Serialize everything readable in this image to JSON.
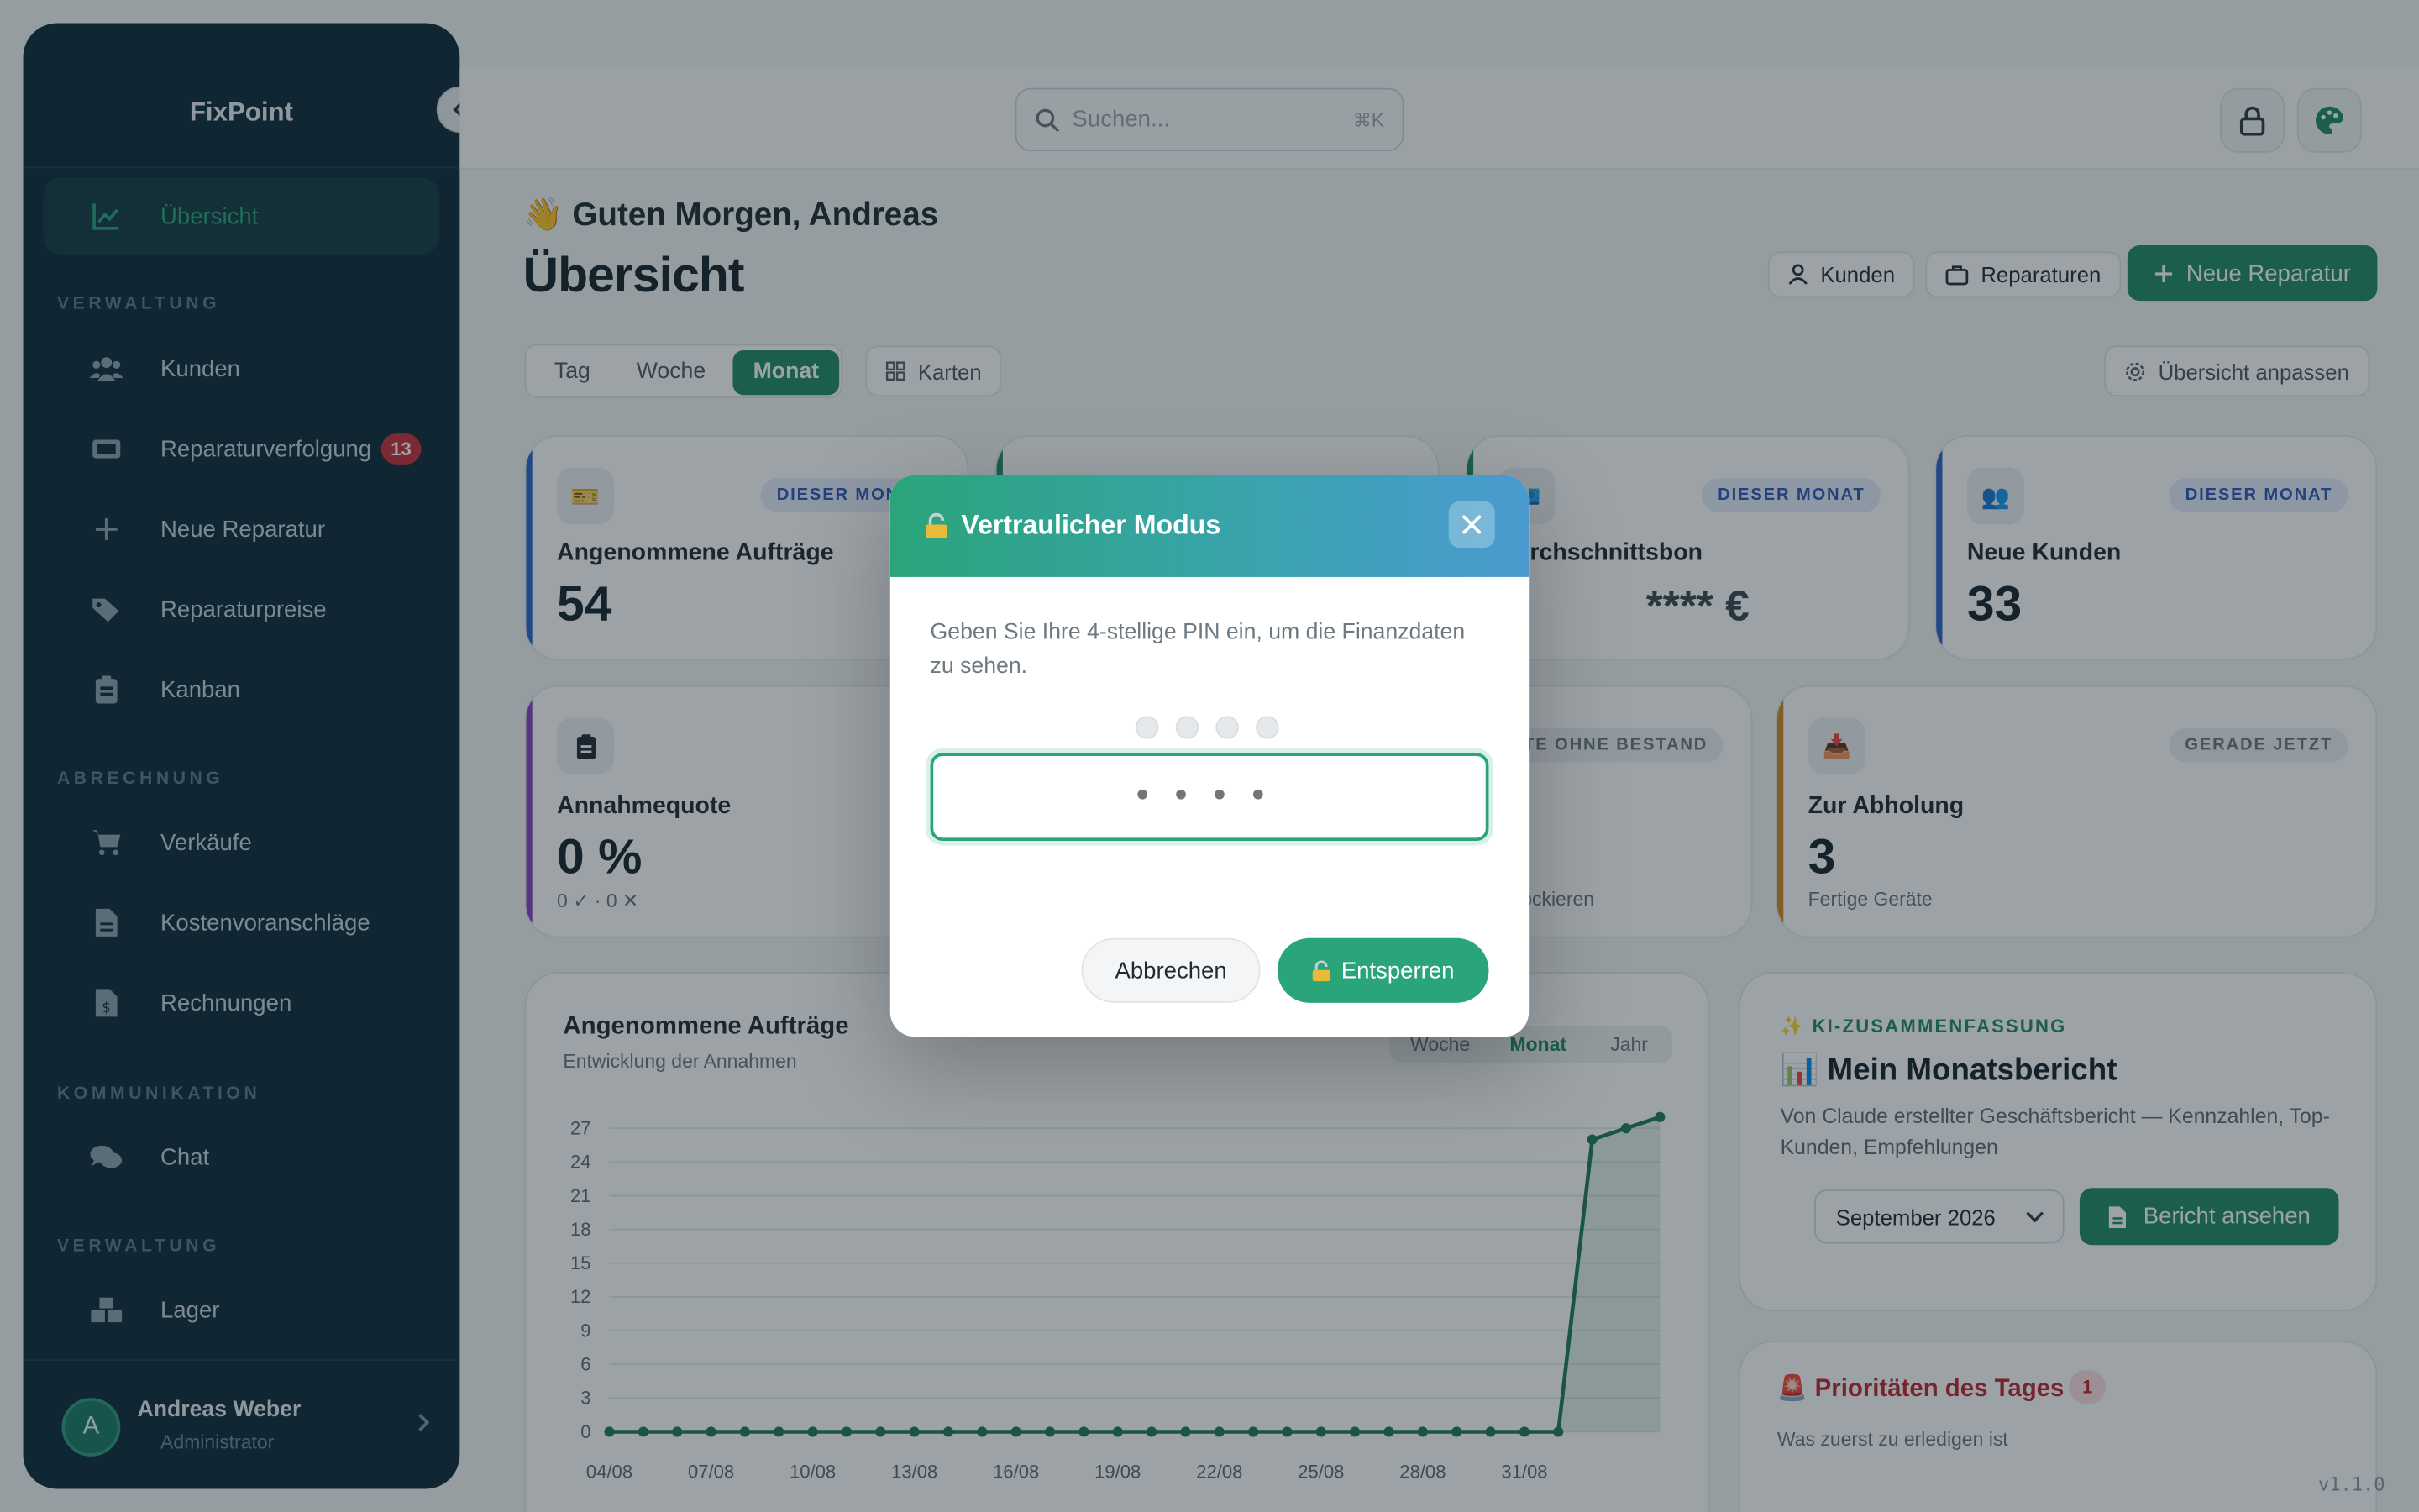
{
  "sidebar": {
    "brand": "FixPoint",
    "items": [
      {
        "label": "Übersicht",
        "icon": "chart-line-icon"
      },
      {
        "label": "Kunden",
        "icon": "users-icon"
      },
      {
        "label": "Reparaturverfolgung",
        "icon": "ticket-icon",
        "badge": "13"
      },
      {
        "label": "Neue Reparatur",
        "icon": "plus-icon"
      },
      {
        "label": "Reparaturpreise",
        "icon": "tags-icon"
      },
      {
        "label": "Kanban",
        "icon": "clipboard-icon"
      },
      {
        "label": "Verkäufe",
        "icon": "cart-icon"
      },
      {
        "label": "Kostenvoranschläge",
        "icon": "file-icon"
      },
      {
        "label": "Rechnungen",
        "icon": "invoice-icon"
      },
      {
        "label": "Chat",
        "icon": "chat-icon"
      },
      {
        "label": "Lager",
        "icon": "boxes-icon"
      }
    ],
    "sections": [
      "VERWALTUNG",
      "ABRECHNUNG",
      "KOMMUNIKATION",
      "VERWALTUNG"
    ],
    "user": {
      "initial": "A",
      "name": "Andreas Weber",
      "role": "Administrator"
    }
  },
  "topbar": {
    "search_placeholder": "Suchen...",
    "search_shortcut": "⌘K"
  },
  "header": {
    "greeting": "👋 Guten Morgen, Andreas",
    "title": "Übersicht",
    "kunden_label": "Kunden",
    "reparaturen_label": "Reparaturen",
    "new_repair_label": "Neue Reparatur",
    "periods": [
      "Tag",
      "Woche",
      "Monat"
    ],
    "active_period": "Monat",
    "cards_label": "Karten",
    "customize_label": "Übersicht anpassen"
  },
  "cards": {
    "c1": {
      "icon": "🎫",
      "pill": "DIESER MONAT",
      "label": "Angenommene Aufträge",
      "value": "54"
    },
    "c3": {
      "icon": "💶",
      "pill": "DIESER MONAT",
      "label": "Durchschnittsbon",
      "value": "**** €"
    },
    "c4": {
      "icon": "👥",
      "pill": "DIESER MONAT",
      "label": "Neue Kunden",
      "value": "33"
    },
    "c5": {
      "label": "Annahmequote",
      "value": "0 %",
      "sub": "0 ✓ · 0 ✕"
    },
    "c6": {
      "pill": "PRODUKTE OHNE BESTAND",
      "sub": "Blockieren"
    },
    "c7": {
      "icon": "📥",
      "pill": "GERADE JETZT",
      "label": "Zur Abholung",
      "value": "3",
      "sub": "Fertige Geräte"
    }
  },
  "chart": {
    "title": "Angenommene Aufträge",
    "subtitle": "Entwicklung der Annahmen",
    "ranges": [
      "Woche",
      "Monat",
      "Jahr"
    ],
    "active_range": "Monat"
  },
  "chart_data": {
    "type": "area",
    "title": "Angenommene Aufträge",
    "x": [
      "04/08",
      "05/08",
      "06/08",
      "07/08",
      "08/08",
      "09/08",
      "10/08",
      "11/08",
      "12/08",
      "13/08",
      "14/08",
      "15/08",
      "16/08",
      "17/08",
      "18/08",
      "19/08",
      "20/08",
      "21/08",
      "22/08",
      "23/08",
      "24/08",
      "25/08",
      "26/08",
      "27/08",
      "28/08",
      "29/08",
      "30/08",
      "31/08",
      "01/09",
      "02/09",
      "03/09"
    ],
    "values": [
      0,
      0,
      0,
      0,
      0,
      0,
      0,
      0,
      0,
      0,
      0,
      0,
      0,
      0,
      0,
      0,
      0,
      0,
      0,
      0,
      0,
      0,
      0,
      0,
      0,
      0,
      0,
      0,
      0,
      26,
      27,
      28
    ],
    "xticks": [
      "04/08",
      "07/08",
      "10/08",
      "13/08",
      "16/08",
      "19/08",
      "22/08",
      "25/08",
      "28/08",
      "31/08"
    ],
    "yticks": [
      0,
      3,
      6,
      9,
      12,
      15,
      18,
      21,
      24,
      27
    ],
    "ylim": [
      0,
      28
    ],
    "grid": true,
    "color": "#1f7a57"
  },
  "ai": {
    "tag": "✨ KI-ZUSAMMENFASSUNG",
    "title": "📊 Mein Monatsbericht",
    "desc": "Von Claude erstellter Geschäftsbericht — Kennzahlen, Top-Kunden, Empfehlungen",
    "month": "September 2026",
    "report_label": "Bericht ansehen"
  },
  "priorities": {
    "title": "🚨 Prioritäten des Tages",
    "count": "1",
    "subtitle": "Was zuerst zu erledigen ist"
  },
  "version": "v1.1.0",
  "modal": {
    "title": "Vertraulicher Modus",
    "text": "Geben Sie Ihre 4-stellige PIN ein, um die Finanzdaten zu sehen.",
    "pin_placeholder": "••••",
    "cancel_label": "Abbrechen",
    "unlock_label": "Entsperren"
  },
  "colors": {
    "brand": "#1f8a62",
    "sidebar_bg": "#0f2a37",
    "danger": "#c0262f"
  }
}
